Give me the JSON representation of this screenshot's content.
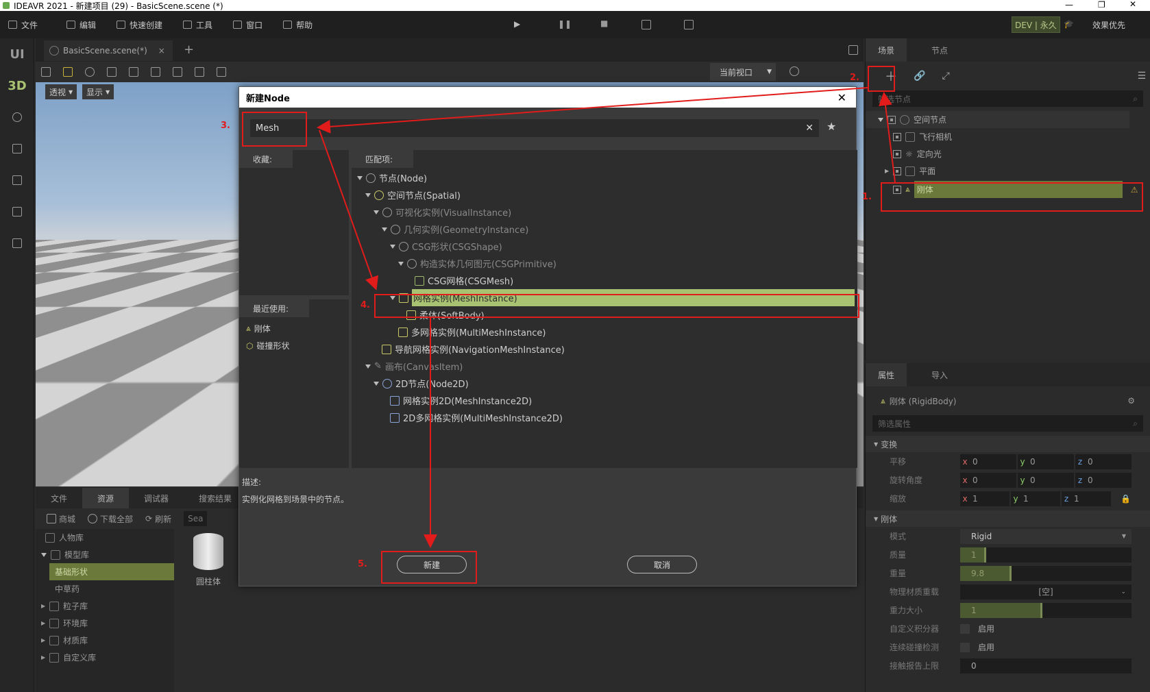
{
  "window": {
    "title": "IDEAVR 2021 - 新建项目 (29) - BasicScene.scene (*)"
  },
  "menu": {
    "file": "文件",
    "edit": "编辑",
    "quick": "快速创建",
    "tools": "工具",
    "window": "窗口",
    "help": "帮助"
  },
  "topright": {
    "dev": "DEV | 永久",
    "effect": "效果优先"
  },
  "lefttools": {
    "ui": "UI",
    "d3": "3D"
  },
  "scene_tab": {
    "name": "BasicScene.scene(*)",
    "close": "×",
    "add": "+"
  },
  "viewport": {
    "view_select": "当前视口",
    "persp": "透视",
    "show": "显示"
  },
  "scene_panel": {
    "tab_scene": "场景",
    "tab_node": "节点",
    "filter": "筛选节点",
    "tree": [
      {
        "label": "空间节点"
      },
      {
        "label": "飞行相机"
      },
      {
        "label": "定向光"
      },
      {
        "label": "平面"
      },
      {
        "label": "刚体"
      }
    ]
  },
  "prop_panel": {
    "tab_prop": "属性",
    "tab_import": "导入",
    "node": "刚体 (RigidBody)",
    "filter": "筛选属性",
    "sect_transform": "变换",
    "translate": "平移",
    "rotate": "旋转角度",
    "scale": "缩放",
    "tx": "0",
    "ty": "0",
    "tz": "0",
    "rx": "0",
    "ry": "0",
    "rz": "0",
    "sx": "1",
    "sy": "1",
    "sz": "1",
    "x": "x",
    "y": "y",
    "z": "z",
    "sect_rigid": "刚体",
    "mode": "模式",
    "mode_val": "Rigid",
    "mass": "质量",
    "mass_val": "1",
    "mass_fill": 0.15,
    "weight": "重量",
    "weight_val": "9.8",
    "weight_fill": 0.3,
    "phys_mat": "物理材质重载",
    "phys_mat_val": "[空]",
    "gravity": "重力大小",
    "gravity_val": "1",
    "gravity_fill": 0.48,
    "custom_int": "自定义积分器",
    "enable1": "启用",
    "ccd": "连续碰撞检测",
    "enable2": "启用",
    "contacts": "接触报告上限",
    "contacts_val": "0"
  },
  "bottom": {
    "tab_file": "文件",
    "tab_res": "资源",
    "tab_debug": "调试器",
    "tab_search": "搜索结果",
    "shop": "商城",
    "download": "下载全部",
    "refresh": "刷新",
    "search": "Sea",
    "libs": [
      {
        "label": "人物库"
      },
      {
        "label": "模型库"
      },
      {
        "label": "基础形状"
      },
      {
        "label": "中草药"
      },
      {
        "label": "粒子库"
      },
      {
        "label": "环境库"
      },
      {
        "label": "材质库"
      },
      {
        "label": "自定义库"
      }
    ],
    "asset": "圆柱体"
  },
  "dialog": {
    "title": "新建Node",
    "search_value": "Mesh",
    "favorites": "收藏:",
    "matches": "匹配项:",
    "recent": "最近使用:",
    "recent_items": [
      {
        "label": "刚体"
      },
      {
        "label": "碰撞形状"
      }
    ],
    "tree": [
      {
        "label": "节点(Node)"
      },
      {
        "label": "空间节点(Spatial)"
      },
      {
        "label": "可视化实例(VisualInstance)"
      },
      {
        "label": "几何实例(GeometryInstance)"
      },
      {
        "label": "CSG形状(CSGShape)"
      },
      {
        "label": "构造实体几何图元(CSGPrimitive)"
      },
      {
        "label": "CSG网格(CSGMesh)"
      },
      {
        "label": "网格实例(MeshInstance)"
      },
      {
        "label": "柔体(SoftBody)"
      },
      {
        "label": "多网格实例(MultiMeshInstance)"
      },
      {
        "label": "导航网格实例(NavigationMeshInstance)"
      },
      {
        "label": "画布(CanvasItem)"
      },
      {
        "label": "2D节点(Node2D)"
      },
      {
        "label": "网格实例2D(MeshInstance2D)"
      },
      {
        "label": "2D多网格实例(MultiMeshInstance2D)"
      }
    ],
    "desc_label": "描述:",
    "desc": "实例化网格到场景中的节点。",
    "create": "新建",
    "cancel": "取消"
  },
  "annotations": {
    "n1": "1.",
    "n2": "2.",
    "n3": "3.",
    "n4": "4.",
    "n5": "5."
  },
  "colors": {
    "highlight": "#a8c271",
    "annotation": "#e21b1b"
  }
}
